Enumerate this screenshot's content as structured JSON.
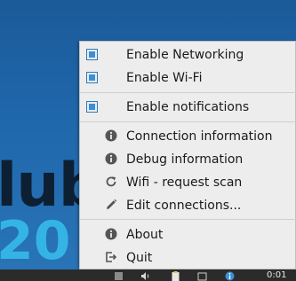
{
  "wallpaper": {
    "text": "lub",
    "year": "20"
  },
  "menu": {
    "toggles": [
      {
        "label": "Enable Networking",
        "checked": true,
        "icon": "checkbox-icon"
      },
      {
        "label": "Enable Wi-Fi",
        "checked": true,
        "icon": "checkbox-icon"
      },
      {
        "label": "Enable notifications",
        "checked": true,
        "icon": "checkbox-icon"
      }
    ],
    "info": [
      {
        "label": "Connection information",
        "icon": "info-icon"
      },
      {
        "label": "Debug information",
        "icon": "info-icon"
      },
      {
        "label": "Wifi - request scan",
        "icon": "refresh-icon"
      },
      {
        "label": "Edit connections...",
        "icon": "pencil-icon"
      }
    ],
    "bottom": [
      {
        "label": "About",
        "icon": "info-icon"
      },
      {
        "label": "Quit",
        "icon": "exit-icon"
      }
    ]
  },
  "taskbar": {
    "clock": "0:01"
  },
  "colors": {
    "checkbox": "#3b8fd6",
    "menu_bg": "#ededed",
    "desktop": "#1e67aa",
    "accent": "#34b4e6"
  }
}
